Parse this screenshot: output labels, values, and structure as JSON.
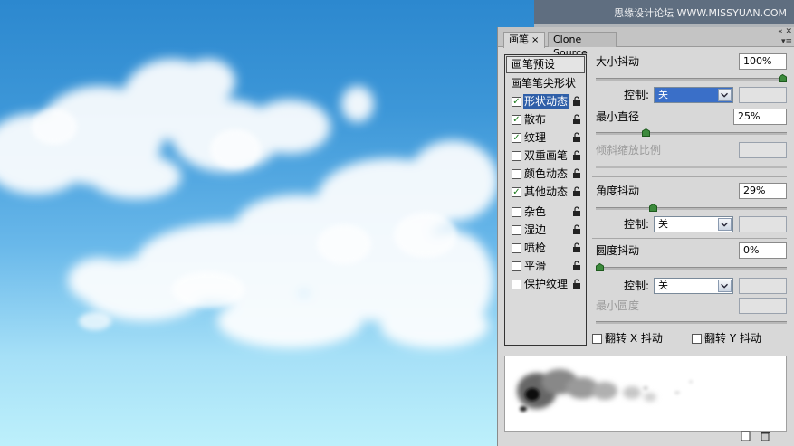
{
  "watermark": "思缘设计论坛 WWW.MISSYUAN.COM",
  "tabs": {
    "active": "画笔",
    "close": "×",
    "inactive": "Clone Source"
  },
  "header_icons": {
    "collapse": "«",
    "close": "✕",
    "menu": "▾≡"
  },
  "brush_list": {
    "preset_button": "画笔预设",
    "tip_shape_label": "画笔笔尖形状",
    "options": [
      {
        "label": "形状动态",
        "checked": true,
        "selected": true
      },
      {
        "label": "散布",
        "checked": true,
        "selected": false
      },
      {
        "label": "纹理",
        "checked": true,
        "selected": false
      },
      {
        "label": "双重画笔",
        "checked": false,
        "selected": false
      },
      {
        "label": "颜色动态",
        "checked": false,
        "selected": false
      },
      {
        "label": "其他动态",
        "checked": true,
        "selected": false
      },
      {
        "label": "杂色",
        "checked": false,
        "selected": false
      },
      {
        "label": "湿边",
        "checked": false,
        "selected": false
      },
      {
        "label": "喷枪",
        "checked": false,
        "selected": false
      },
      {
        "label": "平滑",
        "checked": false,
        "selected": false
      },
      {
        "label": "保护纹理",
        "checked": false,
        "selected": false
      }
    ]
  },
  "shape_dynamics": {
    "size_jitter_label": "大小抖动",
    "size_jitter_value": "100%",
    "size_jitter_fraction": 1.0,
    "control_label": "控制:",
    "size_control_value": "关",
    "min_diameter_label": "最小直径",
    "min_diameter_value": "25%",
    "min_diameter_fraction": 0.25,
    "tilt_scale_label": "倾斜缩放比例",
    "angle_jitter_label": "角度抖动",
    "angle_jitter_value": "29%",
    "angle_jitter_fraction": 0.29,
    "angle_control_value": "关",
    "roundness_jitter_label": "圆度抖动",
    "roundness_jitter_value": "0%",
    "roundness_jitter_fraction": 0.0,
    "roundness_control_value": "关",
    "min_roundness_label": "最小圆度",
    "flip_x_label": "翻转 X 抖动",
    "flip_y_label": "翻转 Y 抖动"
  },
  "colors": {
    "selection": "#2f5fa8",
    "checkmark": "#1a7a1a",
    "slider_thumb": "#3c8a3c"
  }
}
